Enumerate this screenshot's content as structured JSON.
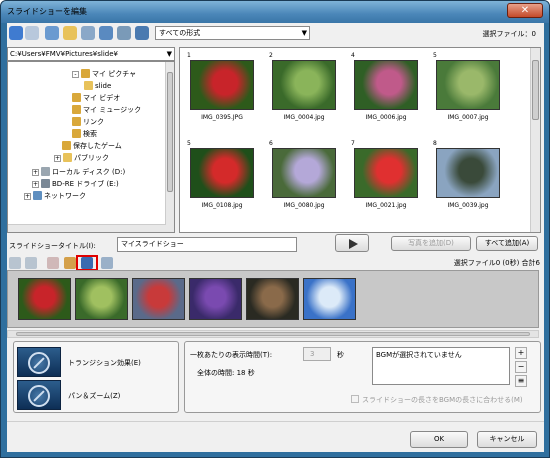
{
  "window": {
    "title": "スライドショーを編集",
    "close_label": "✕"
  },
  "toolbar": {
    "filter_value": "すべての形式",
    "selected_count": "選択ファイル：0"
  },
  "path": "C:¥Users¥FMV¥Pictures¥slide¥",
  "tree": [
    {
      "label": "マイ ピクチャ",
      "icon": "pictures-folder-icon",
      "color": "#d9a83a",
      "expand": "-"
    },
    {
      "label": "slide",
      "icon": "folder-icon",
      "color": "#e8c25a",
      "expand": ""
    },
    {
      "label": "マイ ビデオ",
      "icon": "video-folder-icon",
      "color": "#d9a83a",
      "expand": ""
    },
    {
      "label": "マイ ミュージック",
      "icon": "music-folder-icon",
      "color": "#d9a83a",
      "expand": ""
    },
    {
      "label": "リンク",
      "icon": "links-folder-icon",
      "color": "#d9a83a",
      "expand": ""
    },
    {
      "label": "検索",
      "icon": "search-folder-icon",
      "color": "#d9a83a",
      "expand": ""
    },
    {
      "label": "保存したゲーム",
      "icon": "games-folder-icon",
      "color": "#d9a83a",
      "expand": ""
    },
    {
      "label": "パブリック",
      "icon": "public-folder-icon",
      "color": "#e8c25a",
      "expand": "+"
    },
    {
      "label": "ローカル ディスク (D:)",
      "icon": "drive-icon",
      "color": "#9aa6b0",
      "expand": "+"
    },
    {
      "label": "BD-RE ドライブ (E:)",
      "icon": "optical-drive-icon",
      "color": "#7a8896",
      "expand": "+"
    },
    {
      "label": "ネットワーク",
      "icon": "network-icon",
      "color": "#5f8fc0",
      "expand": "+"
    }
  ],
  "thumbnails": [
    {
      "num": "1",
      "name": "IMG_0395.JPG",
      "palette": [
        "#2d5a1a",
        "#c8242a"
      ]
    },
    {
      "num": "2",
      "name": "IMG_0004.jpg",
      "palette": [
        "#3a6a2a",
        "#8ab45a"
      ]
    },
    {
      "num": "4",
      "name": "IMG_0006.jpg",
      "palette": [
        "#2f5f25",
        "#c05a8a"
      ]
    },
    {
      "num": "5",
      "name": "IMG_0007.jpg",
      "palette": [
        "#4a7a3a",
        "#9ab86a"
      ]
    },
    {
      "num": "5",
      "name": "IMG_0108.jpg",
      "palette": [
        "#1f4f1a",
        "#d42a2a"
      ]
    },
    {
      "num": "6",
      "name": "IMG_0080.jpg",
      "palette": [
        "#4a6a3a",
        "#b4a8d8"
      ]
    },
    {
      "num": "7",
      "name": "IMG_0021.jpg",
      "palette": [
        "#3a6a2a",
        "#e03030"
      ]
    },
    {
      "num": "8",
      "name": "IMG_0039.jpg",
      "palette": [
        "#8aa4c0",
        "#3a4a3a"
      ]
    }
  ],
  "slideshow": {
    "title_label": "スライドショータイトル(I):",
    "title_value": "マイスライドショー",
    "add_label": "写真を追加(D)",
    "add_all_label": "すべて追加(A)",
    "selected_info": "選択ファイル0 (0秒)  合計6"
  },
  "storyboard": [
    {
      "name": "red-flower",
      "palette": [
        "#2d5a1a",
        "#c8242a"
      ]
    },
    {
      "name": "green-leaves",
      "palette": [
        "#3a6a2a",
        "#a0c060"
      ]
    },
    {
      "name": "red-tree",
      "palette": [
        "#5a6a8a",
        "#c83a3a"
      ]
    },
    {
      "name": "purple-pansy",
      "palette": [
        "#3a2a6a",
        "#7a4ab0"
      ]
    },
    {
      "name": "pinecone",
      "palette": [
        "#2a2a22",
        "#8a6a4a"
      ]
    },
    {
      "name": "blue-sky",
      "palette": [
        "#3a72c8",
        "#dceaf8"
      ]
    }
  ],
  "effects": {
    "transition_label": "トランジション効果(E)",
    "pan_zoom_label": "パン＆ズーム(Z)"
  },
  "timing": {
    "per_slide_label": "一枚あたりの表示時間(T):",
    "per_slide_value": "3",
    "unit": "秒",
    "total_label": "全体の時間: 18 秒"
  },
  "bgm": {
    "text": "BGMが選択されていません",
    "fit_label": "スライドショーの長さをBGMの長さに合わせる(M)"
  },
  "footer": {
    "ok_label": "OK",
    "cancel_label": "キャンセル"
  }
}
